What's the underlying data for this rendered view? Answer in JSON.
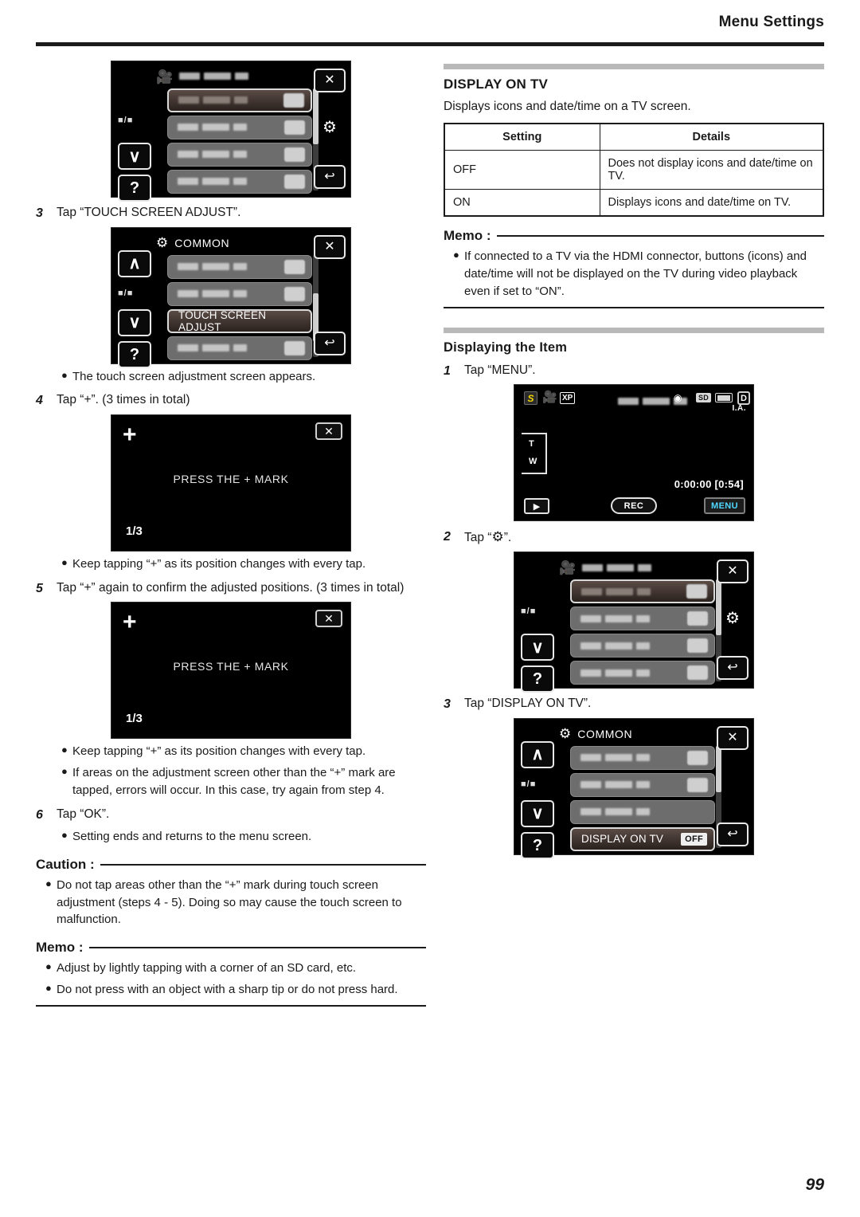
{
  "header": {
    "title": "Menu Settings"
  },
  "page_number": "99",
  "left": {
    "screen1": {
      "title_icon": "camcorder-icon",
      "rows": [
        "redacted",
        "redacted",
        "redacted",
        "redacted"
      ],
      "close_label": "✕",
      "gear_label": "⚙",
      "back_label": "↩",
      "down_label": "∨",
      "help_label": "?",
      "mode_label": "■/■"
    },
    "step3": {
      "num": "3",
      "text": "Tap “TOUCH SCREEN ADJUST”."
    },
    "screen2": {
      "title": "COMMON",
      "highlight_row_label": "TOUCH SCREEN ADJUST",
      "close_label": "✕",
      "up_label": "∧",
      "down_label": "∨",
      "help_label": "?",
      "back_label": "↩",
      "mode_label": "■/■"
    },
    "bullet_after_3": "The touch screen adjustment screen appears.",
    "step4": {
      "num": "4",
      "text": "Tap “+”. (3 times in total)"
    },
    "adjust_screen_1": {
      "plus": "+",
      "message": "PRESS THE + MARK",
      "count": "1/3",
      "close_label": "✕"
    },
    "bullet_after_4": "Keep tapping “+” as its position changes with every tap.",
    "step5": {
      "num": "5",
      "text": "Tap “+” again to confirm the adjusted positions. (3 times in total)"
    },
    "adjust_screen_2": {
      "plus": "+",
      "message": "PRESS THE + MARK",
      "count": "1/3",
      "close_label": "✕"
    },
    "bullets_after_5": [
      "Keep tapping “+” as its position changes with every tap.",
      "If areas on the adjustment screen other than the “+” mark are tapped, errors will occur. In this case, try again from step 4."
    ],
    "step6": {
      "num": "6",
      "text": "Tap “OK”."
    },
    "bullet_after_6": "Setting ends and returns to the menu screen.",
    "caution": {
      "label": "Caution :",
      "items": [
        "Do not tap areas other than the “+” mark during touch screen adjustment (steps 4 - 5). Doing so may cause the touch screen to malfunction."
      ]
    },
    "memo": {
      "label": "Memo :",
      "items": [
        "Adjust by lightly tapping with a corner of an SD card, etc.",
        "Do not press with an object with a sharp tip or do not press hard."
      ]
    }
  },
  "right": {
    "section_title": "DISPLAY ON TV",
    "description": "Displays icons and date/time on a TV screen.",
    "table": {
      "headers": [
        "Setting",
        "Details"
      ],
      "rows": [
        [
          "OFF",
          "Does not display icons and date/time on TV."
        ],
        [
          "ON",
          "Displays icons and date/time on TV."
        ]
      ]
    },
    "memo": {
      "label": "Memo :",
      "items": [
        "If connected to a TV via the HDMI connector, buttons (icons) and date/time will not be displayed on the TV during video playback even if set to “ON”."
      ]
    },
    "sub_title": "Displaying the Item",
    "step1": {
      "num": "1",
      "text": "Tap “MENU”."
    },
    "cam_screen": {
      "s_badge": "S",
      "quality": "XP",
      "sd_label": "SD",
      "d_label": "D",
      "ia_label": "I.A.",
      "zoom_tele": "T",
      "zoom_wide": "W",
      "timecode": "0:00:00  [0:54]",
      "play_label": "▶",
      "rec_label": "REC",
      "menu_label": "MENU"
    },
    "step2": {
      "num": "2",
      "text_before": "Tap “",
      "icon": "gear-icon",
      "text_after": "”."
    },
    "screen_menu": {
      "close_label": "✕",
      "gear_label": "⚙",
      "back_label": "↩",
      "down_label": "∨",
      "help_label": "?",
      "mode_label": "■/■"
    },
    "step3": {
      "num": "3",
      "text": "Tap “DISPLAY ON TV”."
    },
    "screen_common": {
      "title": "COMMON",
      "highlight_row_label": "DISPLAY ON TV",
      "highlight_row_value": "OFF",
      "close_label": "✕",
      "up_label": "∧",
      "down_label": "∨",
      "help_label": "?",
      "back_label": "↩",
      "mode_label": "■/■"
    }
  }
}
